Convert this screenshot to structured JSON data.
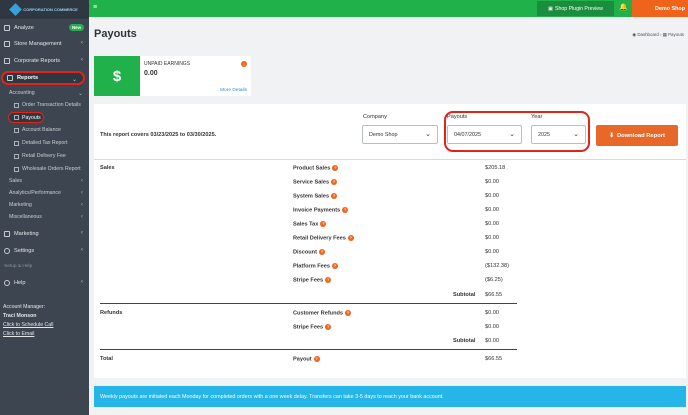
{
  "sidebar": {
    "logo_text": "CORPORATION COMMERCE",
    "analyze": "Analyze",
    "analyze_badge": "New",
    "store_management": "Store Management",
    "corporate_reports": "Corporate Reports",
    "reports": "Reports",
    "accounting": "Accounting",
    "order_transaction_details": "Order Transaction Details",
    "payouts": "Payouts",
    "account_balance": "Account Balance",
    "detailed_tax_report": "Detailed Tax Report",
    "retail_delivery_fee": "Retail Delivery Fee",
    "wholesale_orders_report": "Wholesale Orders Report",
    "sales": "Sales",
    "analytics_performance": "Analytics/Performance",
    "marketing_sub": "Marketing",
    "miscellaneous": "Miscellaneous",
    "marketing": "Marketing",
    "settings": "Settings",
    "setup_help": "Setup & Help",
    "help": "Help",
    "account_manager_label": "Account Manager:",
    "account_manager_name": "Traci Monson",
    "schedule_call": "Click to Schedule Call",
    "email": "Click to Email"
  },
  "topbar": {
    "plugin_preview": "Shop Plugin Preview",
    "demo_shop": "Demo Shop"
  },
  "page": {
    "title": "Payouts",
    "breadcrumb_home": "Dashboard",
    "breadcrumb_current": "Payouts"
  },
  "earnings_card": {
    "symbol": "$",
    "label": "UNPAID EARNINGS",
    "amount": "0.00",
    "more": "More Details"
  },
  "filters": {
    "covers_text": "This report covers 03/23/2025 to 03/30/2025.",
    "company_label": "Company",
    "company_value": "Demo Shop",
    "payouts_label": "Payouts",
    "payouts_value": "04/07/2025",
    "year_label": "Year",
    "year_value": "2025",
    "download": "Download Report"
  },
  "report": {
    "sales_label": "Sales",
    "refunds_label": "Refunds",
    "total_label": "Total",
    "subtotal_label": "Subtotal",
    "sales_rows": [
      {
        "label": "Product Sales",
        "value": "$205.18"
      },
      {
        "label": "Service Sales",
        "value": "$0.00"
      },
      {
        "label": "System Sales",
        "value": "$0.00"
      },
      {
        "label": "Invoice Payments",
        "value": "$0.00"
      },
      {
        "label": "Sales Tax",
        "value": "$0.00"
      },
      {
        "label": "Retail Delivery Fees",
        "value": "$0.00"
      },
      {
        "label": "Discount",
        "value": "$0.00"
      },
      {
        "label": "Platform Fees",
        "value": "($132.38)"
      },
      {
        "label": "Stripe Fees",
        "value": "($6.25)"
      }
    ],
    "sales_subtotal": "$66.55",
    "refund_rows": [
      {
        "label": "Customer Refunds",
        "value": "$0.00"
      },
      {
        "label": "Stripe Fees",
        "value": "$0.00"
      }
    ],
    "refunds_subtotal": "$0.00",
    "payout_label": "Payout",
    "payout_value": "$66.55"
  },
  "notice": "Weekly payouts are initiated each Monday for completed orders with a one week delay. Transfers can take 3-5 days to reach your bank account."
}
